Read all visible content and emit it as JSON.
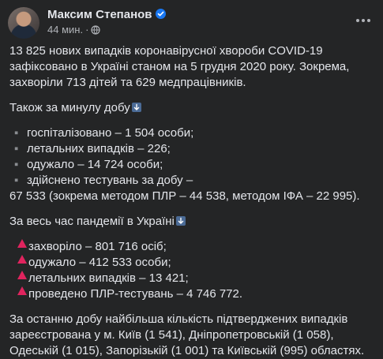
{
  "post": {
    "author": "Максим Степанов",
    "time": "44 мин.",
    "separator": "·"
  },
  "content": {
    "intro": "13 825 нових випадків коронавірусної хвороби COVID-19 зафіксовано в Україні станом на 5 грудня 2020 року. Зокрема, захворіли 713 дітей та 629 медпрацівників.",
    "day_heading": "Також за минулу добу",
    "day_items": [
      "госпіталізовано – 1 504 особи;",
      "летальних випадків – 226;",
      "одужало – 14 724 особи;",
      "здійснено тестувань за добу –"
    ],
    "day_continuation": "67 533 (зокрема методом ПЛР – 44 538, методом ІФА – 22 995).",
    "total_heading": "За весь час пандемії в Україні",
    "total_items": [
      "захворіло – 801 716 осіб;",
      "одужало – 412 533 особи;",
      "летальних випадків – 13 421;",
      "проведено ПЛР-тестувань – 4 746 772."
    ],
    "outro": "За останню добу найбільша кількість підтверджених випадків зареєстрована у м. Київ (1 541), Дніпропетровській (1 058), Одеській (1 015), Запорізькій (1 001) та Київській (995) областях."
  },
  "colors": {
    "background": "#242526",
    "text": "#e4e6eb",
    "secondary_text": "#b0b3b8",
    "verified_badge": "#1877f2",
    "triangle_emoji": "#e0245e"
  },
  "icons": {
    "verified": "verified-badge-icon",
    "audience": "globe-icon",
    "more": "more-options-icon",
    "down_arrow_emoji": "down-arrow-emoji-icon",
    "red_triangle_emoji": "red-triangle-icon"
  }
}
